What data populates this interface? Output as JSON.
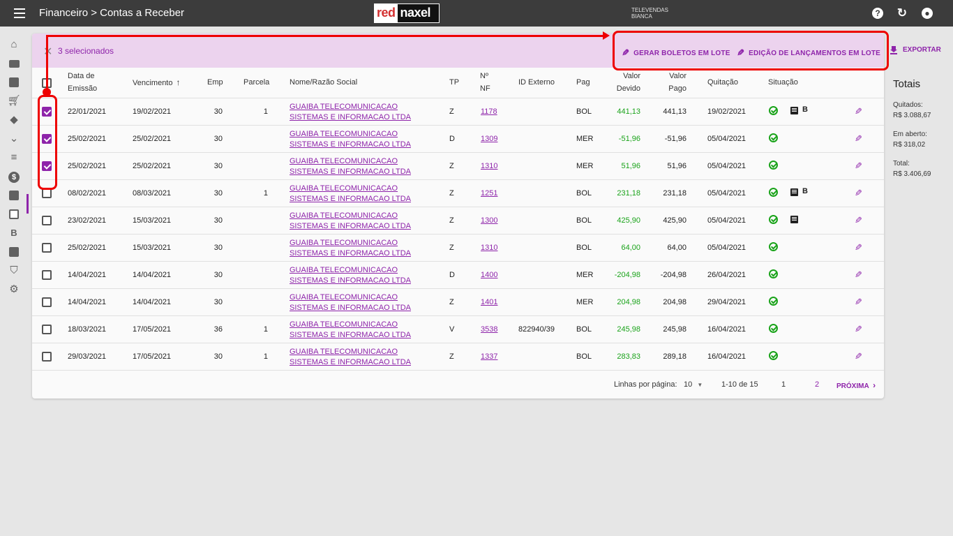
{
  "header": {
    "breadcrumb": "Financeiro > Contas a Receber",
    "logo_red": "red",
    "logo_rest": "naxel",
    "user_line1": "TELEVENDAS",
    "user_line2": "BIANCA",
    "help_icon": "help-circle-icon",
    "refresh_icon": "refresh-icon",
    "account_icon": "account-circle-icon"
  },
  "sidebar": {
    "items": [
      {
        "icon": "home-icon"
      },
      {
        "icon": "folder-icon"
      },
      {
        "icon": "briefcase-play-icon"
      },
      {
        "icon": "cart-icon"
      },
      {
        "icon": "tag-icon"
      },
      {
        "icon": "chevron-down-icon"
      },
      {
        "icon": "playlist-check-icon"
      },
      {
        "icon": "currency-icon",
        "active": true
      },
      {
        "icon": "badge-account-icon"
      },
      {
        "icon": "receipt-icon"
      },
      {
        "icon": "letter-b-icon",
        "text": "B"
      },
      {
        "icon": "image-multiple-icon"
      },
      {
        "icon": "shield-icon"
      },
      {
        "icon": "settings-icon"
      }
    ]
  },
  "selection": {
    "count_text": "3 selecionados",
    "action1": "GERAR BOLETOS EM LOTE",
    "action2": "EDIÇÃO DE LANÇAMENTOS EM LOTE"
  },
  "table": {
    "headers": {
      "emissao1": "Data de",
      "emissao2": "Emissão",
      "vencimento": "Vencimento",
      "emp": "Emp",
      "parcela": "Parcela",
      "nome": "Nome/Razão Social",
      "tp": "TP",
      "nf1": "Nº",
      "nf2": "NF",
      "idext": "ID Externo",
      "pag": "Pag",
      "devido1": "Valor",
      "devido2": "Devido",
      "pago1": "Valor",
      "pago2": "Pago",
      "quitacao": "Quitação",
      "situacao": "Situação"
    },
    "rows": [
      {
        "checked": true,
        "emissao": "22/01/2021",
        "vencimento": "19/02/2021",
        "emp": "30",
        "parcela": "1",
        "nome": "GUAIBA TELECOMUNICACAO SISTEMAS E INFORMACAO LTDA",
        "tp": "Z",
        "nf": "1178",
        "idext": "",
        "pag": "BOL",
        "devido": "441,13",
        "pago": "441,13",
        "quitacao": "19/02/2021",
        "doc": true,
        "boleto": true
      },
      {
        "checked": true,
        "emissao": "25/02/2021",
        "vencimento": "25/02/2021",
        "emp": "30",
        "parcela": "",
        "nome": "GUAIBA TELECOMUNICACAO SISTEMAS E INFORMACAO LTDA",
        "tp": "D",
        "nf": "1309",
        "idext": "",
        "pag": "MER",
        "devido": "-51,96",
        "pago": "-51,96",
        "quitacao": "05/04/2021",
        "doc": false,
        "boleto": false
      },
      {
        "checked": true,
        "emissao": "25/02/2021",
        "vencimento": "25/02/2021",
        "emp": "30",
        "parcela": "",
        "nome": "GUAIBA TELECOMUNICACAO SISTEMAS E INFORMACAO LTDA",
        "tp": "Z",
        "nf": "1310",
        "idext": "",
        "pag": "MER",
        "devido": "51,96",
        "pago": "51,96",
        "quitacao": "05/04/2021",
        "doc": false,
        "boleto": false
      },
      {
        "checked": false,
        "emissao": "08/02/2021",
        "vencimento": "08/03/2021",
        "emp": "30",
        "parcela": "1",
        "nome": "GUAIBA TELECOMUNICACAO SISTEMAS E INFORMACAO LTDA",
        "tp": "Z",
        "nf": "1251",
        "idext": "",
        "pag": "BOL",
        "devido": "231,18",
        "pago": "231,18",
        "quitacao": "05/04/2021",
        "doc": true,
        "boleto": true
      },
      {
        "checked": false,
        "emissao": "23/02/2021",
        "vencimento": "15/03/2021",
        "emp": "30",
        "parcela": "",
        "nome": "GUAIBA TELECOMUNICACAO SISTEMAS E INFORMACAO LTDA",
        "tp": "Z",
        "nf": "1300",
        "idext": "",
        "pag": "BOL",
        "devido": "425,90",
        "pago": "425,90",
        "quitacao": "05/04/2021",
        "doc": true,
        "boleto": false
      },
      {
        "checked": false,
        "emissao": "25/02/2021",
        "vencimento": "15/03/2021",
        "emp": "30",
        "parcela": "",
        "nome": "GUAIBA TELECOMUNICACAO SISTEMAS E INFORMACAO LTDA",
        "tp": "Z",
        "nf": "1310",
        "idext": "",
        "pag": "BOL",
        "devido": "64,00",
        "pago": "64,00",
        "quitacao": "05/04/2021",
        "doc": false,
        "boleto": false
      },
      {
        "checked": false,
        "emissao": "14/04/2021",
        "vencimento": "14/04/2021",
        "emp": "30",
        "parcela": "",
        "nome": "GUAIBA TELECOMUNICACAO SISTEMAS E INFORMACAO LTDA",
        "tp": "D",
        "nf": "1400",
        "idext": "",
        "pag": "MER",
        "devido": "-204,98",
        "pago": "-204,98",
        "quitacao": "26/04/2021",
        "doc": false,
        "boleto": false
      },
      {
        "checked": false,
        "emissao": "14/04/2021",
        "vencimento": "14/04/2021",
        "emp": "30",
        "parcela": "",
        "nome": "GUAIBA TELECOMUNICACAO SISTEMAS E INFORMACAO LTDA",
        "tp": "Z",
        "nf": "1401",
        "idext": "",
        "pag": "MER",
        "devido": "204,98",
        "pago": "204,98",
        "quitacao": "29/04/2021",
        "doc": false,
        "boleto": false
      },
      {
        "checked": false,
        "emissao": "18/03/2021",
        "vencimento": "17/05/2021",
        "emp": "36",
        "parcela": "1",
        "nome": "GUAIBA TELECOMUNICACAO SISTEMAS E INFORMACAO LTDA",
        "tp": "V",
        "nf": "3538",
        "idext": "822940/39",
        "pag": "BOL",
        "devido": "245,98",
        "pago": "245,98",
        "quitacao": "16/04/2021",
        "doc": false,
        "boleto": false
      },
      {
        "checked": false,
        "emissao": "29/03/2021",
        "vencimento": "17/05/2021",
        "emp": "30",
        "parcela": "1",
        "nome": "GUAIBA TELECOMUNICACAO SISTEMAS E INFORMACAO LTDA",
        "tp": "Z",
        "nf": "1337",
        "idext": "",
        "pag": "BOL",
        "devido": "283,83",
        "pago": "289,18",
        "quitacao": "16/04/2021",
        "doc": false,
        "boleto": false
      }
    ]
  },
  "pagination": {
    "rows_label": "Linhas por página:",
    "rows_value": "10",
    "range": "1-10 de 15",
    "page1": "1",
    "page2": "2",
    "next": "PRÓXIMA"
  },
  "export_label": "EXPORTAR",
  "totals": {
    "title": "Totais",
    "quitados_label": "Quitados:",
    "quitados_value": "R$ 3.088,67",
    "aberto_label": "Em aberto:",
    "aberto_value": "R$ 318,02",
    "total_label": "Total:",
    "total_value": "R$ 3.406,69"
  },
  "colors": {
    "accent": "#8e24aa",
    "positive": "#1aa31a",
    "annotation": "#ee0000",
    "topbar": "#3c3c3c"
  }
}
